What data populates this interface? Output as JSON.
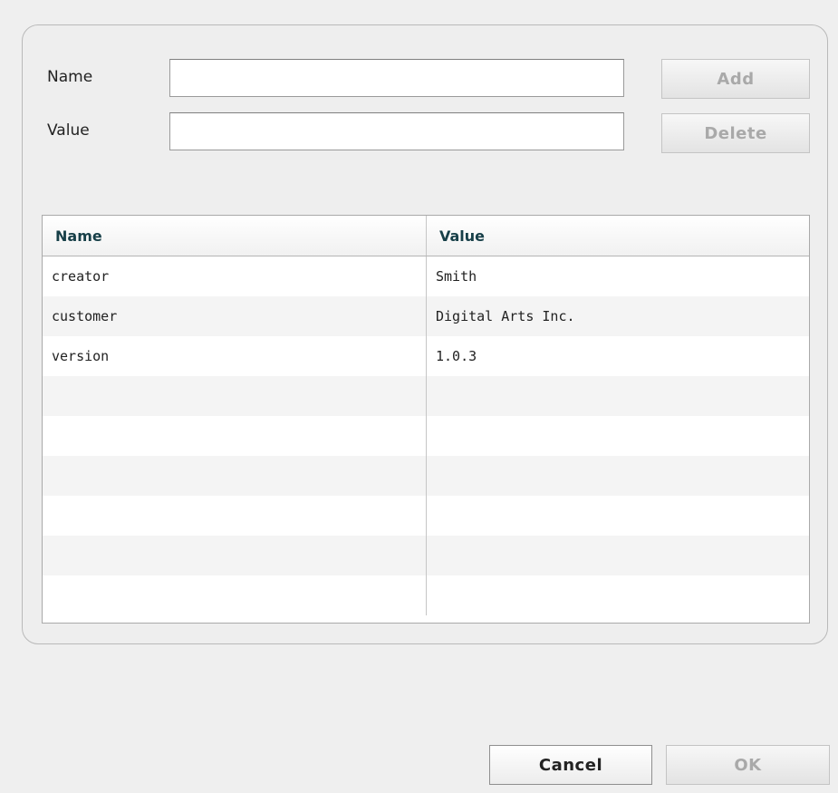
{
  "form": {
    "name_label": "Name",
    "value_label": "Value",
    "name_value": "",
    "value_value": "",
    "add_label": "Add",
    "delete_label": "Delete"
  },
  "table": {
    "columns": [
      "Name",
      "Value"
    ],
    "rows": [
      {
        "name": "creator",
        "value": "Smith"
      },
      {
        "name": "customer",
        "value": "Digital Arts Inc."
      },
      {
        "name": "version",
        "value": "1.0.3"
      },
      {
        "name": "",
        "value": ""
      },
      {
        "name": "",
        "value": ""
      },
      {
        "name": "",
        "value": ""
      },
      {
        "name": "",
        "value": ""
      },
      {
        "name": "",
        "value": ""
      },
      {
        "name": "",
        "value": ""
      }
    ]
  },
  "footer": {
    "cancel_label": "Cancel",
    "ok_label": "OK"
  },
  "colors": {
    "header_text": "#173f48",
    "disabled_text": "#a9a9a9"
  }
}
